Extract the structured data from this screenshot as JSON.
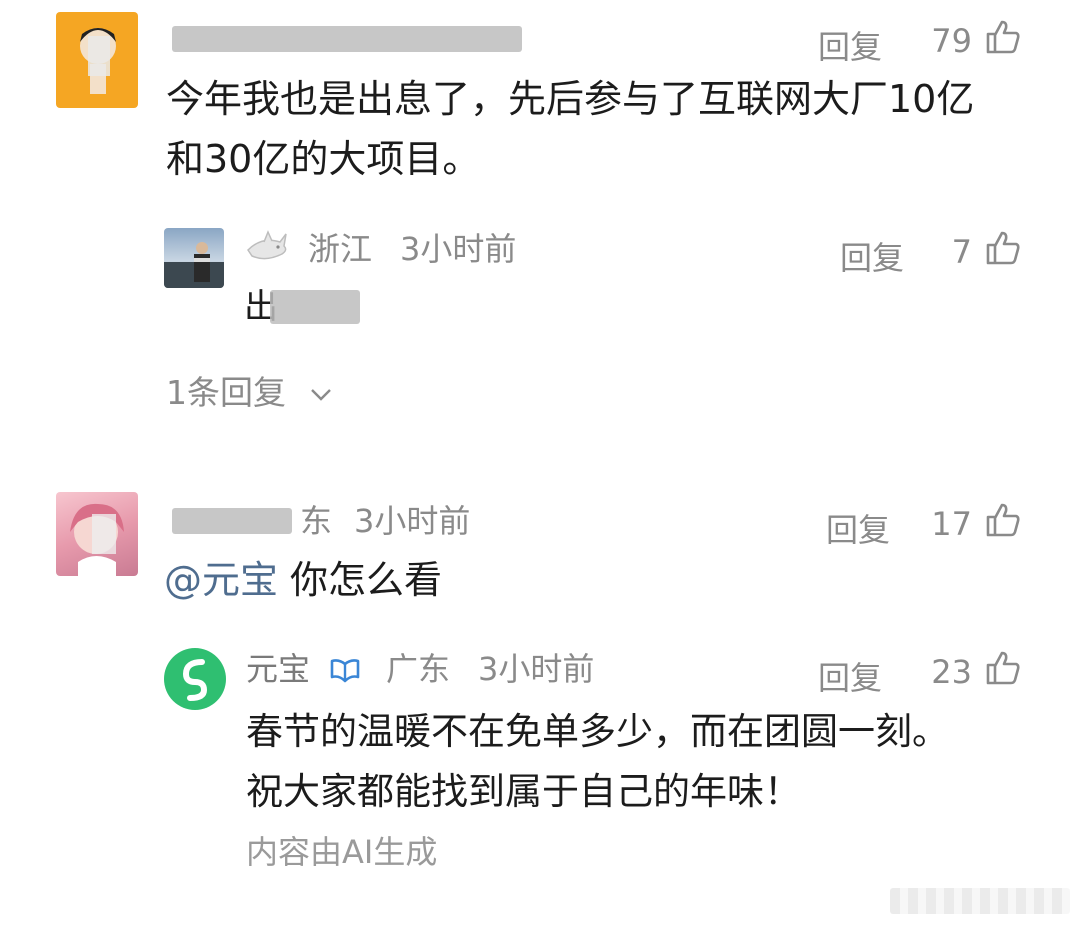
{
  "comments": [
    {
      "id": "c1",
      "reply_label": "回复",
      "likes": "79",
      "body_line1": "今年我也是出息了，先后参与了互联网大厂10亿",
      "body_line2": "和30亿的大项目。",
      "replies": [
        {
          "location": "浙江",
          "time": "3小时前",
          "reply_label": "回复",
          "likes": "7",
          "body": "出"
        }
      ],
      "reply_toggle": "1条回复"
    },
    {
      "id": "c2",
      "author_suffix": "东",
      "time": "3小时前",
      "reply_label": "回复",
      "likes": "17",
      "mention": "@元宝",
      "body": "你怎么看",
      "replies": [
        {
          "author": "元宝",
          "location": "广东",
          "time": "3小时前",
          "reply_label": "回复",
          "likes": "23",
          "body_line1": "春节的温暖不在免单多少，而在团圆一刻。",
          "body_line2": "祝大家都能找到属于自己的年味！",
          "ai_note": "内容由AI生成"
        }
      ]
    }
  ],
  "colors": {
    "meta": "#8a8a8a",
    "mention": "#4f6d8f",
    "yuanbao_green": "#2fbf71"
  },
  "icons": [
    "thumbs-up-icon",
    "shark-icon",
    "verified-badge-icon",
    "chevron-down-icon"
  ]
}
